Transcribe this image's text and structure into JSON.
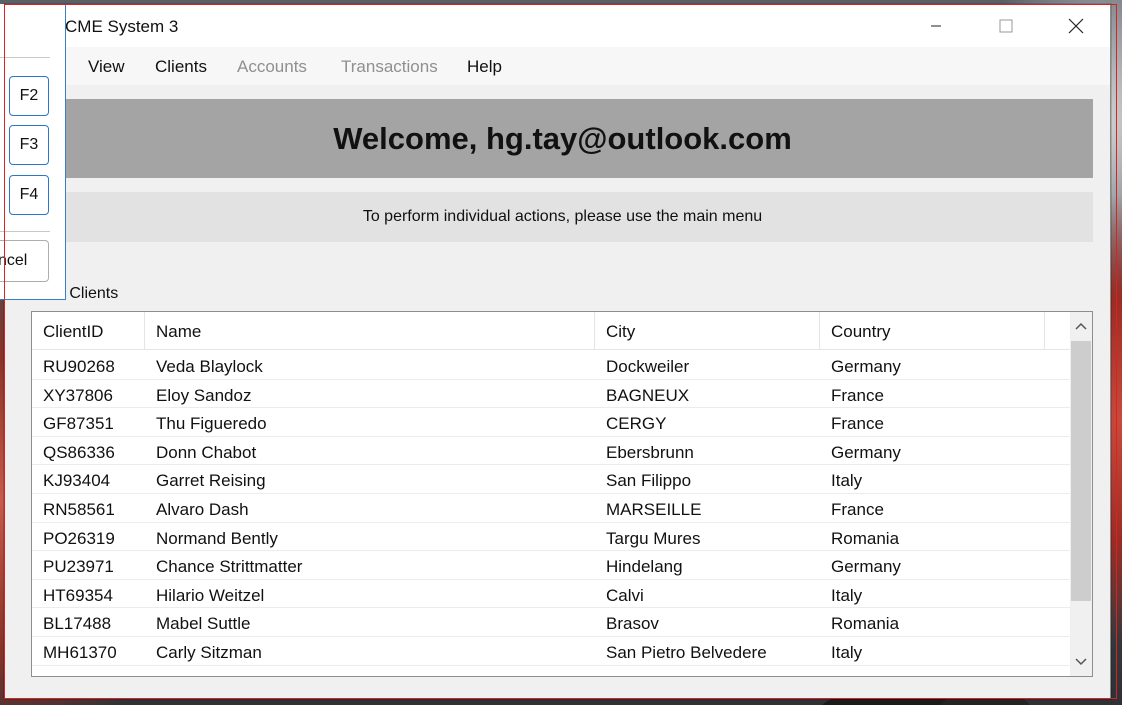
{
  "window": {
    "title": "CME System 3"
  },
  "menu": {
    "items": [
      {
        "label": "View",
        "enabled": true
      },
      {
        "label": "Clients",
        "enabled": true
      },
      {
        "label": "Accounts",
        "enabled": false
      },
      {
        "label": "Transactions",
        "enabled": false
      },
      {
        "label": "Help",
        "enabled": true
      }
    ]
  },
  "banner": {
    "welcome": "Welcome, hg.tay@outlook.com"
  },
  "info": {
    "text": "To perform individual actions, please use the main menu"
  },
  "clients": {
    "section_label": "west Clients",
    "columns": [
      "ClientID",
      "Name",
      "City",
      "Country"
    ],
    "rows": [
      [
        "RU90268",
        "Veda Blaylock",
        "Dockweiler",
        "Germany"
      ],
      [
        "XY37806",
        "Eloy Sandoz",
        "BAGNEUX",
        "France"
      ],
      [
        "GF87351",
        "Thu Figueredo",
        "CERGY",
        "France"
      ],
      [
        "QS86336",
        "Donn Chabot",
        "Ebersbrunn",
        "Germany"
      ],
      [
        "KJ93404",
        "Garret Reising",
        "San Filippo",
        "Italy"
      ],
      [
        "RN58561",
        "Alvaro Dash",
        "MARSEILLE",
        "France"
      ],
      [
        "PO26319",
        "Normand Bently",
        "Targu Mures",
        "Romania"
      ],
      [
        "PU23971",
        "Chance Strittmatter",
        "Hindelang",
        "Germany"
      ],
      [
        "HT69354",
        "Hilario Weitzel",
        "Calvi",
        "Italy"
      ],
      [
        "BL17488",
        "Mabel Suttle",
        "Brasov",
        "Romania"
      ],
      [
        "MH61370",
        "Carly Sitzman",
        "San Pietro Belvedere",
        "Italy"
      ]
    ]
  },
  "popup": {
    "keys": [
      "F2",
      "F3",
      "F4"
    ],
    "cancel_label": "ncel"
  },
  "icons": {
    "minimize": "minimize-icon",
    "maximize": "maximize-icon",
    "close": "close-icon",
    "scroll_up": "chevron-up-icon",
    "scroll_down": "chevron-down-icon"
  },
  "colors": {
    "banner_bg": "#a4a4a4",
    "info_bg": "#e2e2e2",
    "accent_border": "#2a77c9",
    "highlight_frame": "#d42424"
  }
}
